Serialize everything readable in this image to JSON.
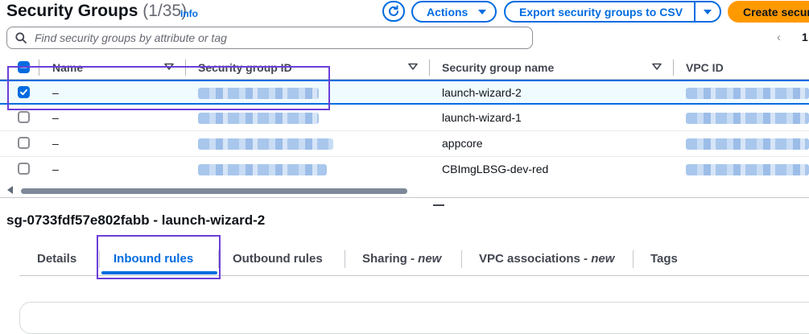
{
  "header": {
    "title": "Security Groups",
    "count": "(1/35)",
    "info_label": "Info",
    "refresh_icon": "refresh-icon",
    "actions_label": "Actions",
    "export_label": "Export security groups to CSV",
    "create_label": "Create secur"
  },
  "search": {
    "placeholder": "Find security groups by attribute or tag",
    "value": ""
  },
  "pagination": {
    "current_page": "1"
  },
  "table": {
    "columns": [
      "Name",
      "Security group ID",
      "Security group name",
      "VPC ID"
    ],
    "rows": [
      {
        "selected": true,
        "name": "–",
        "group_name": "launch-wizard-2"
      },
      {
        "selected": false,
        "name": "–",
        "group_name": "launch-wizard-1"
      },
      {
        "selected": false,
        "name": "–",
        "group_name": "appcore"
      },
      {
        "selected": false,
        "name": "–",
        "group_name": "CBImgLBSG-dev-red"
      }
    ]
  },
  "detail": {
    "title": "sg-0733fdf57e802fabb - launch-wizard-2",
    "tabs": [
      {
        "label": "Details",
        "suffix": ""
      },
      {
        "label": "Inbound rules",
        "suffix": ""
      },
      {
        "label": "Outbound rules",
        "suffix": ""
      },
      {
        "label": "Sharing - ",
        "suffix": "new"
      },
      {
        "label": "VPC associations - ",
        "suffix": "new"
      },
      {
        "label": "Tags",
        "suffix": ""
      }
    ],
    "active_tab": "Inbound rules"
  },
  "colors": {
    "accent": "#006ce0",
    "primary_button": "#ff9900",
    "annotation": "#6a3fd8",
    "selected_row_bg": "#f0fbff"
  }
}
